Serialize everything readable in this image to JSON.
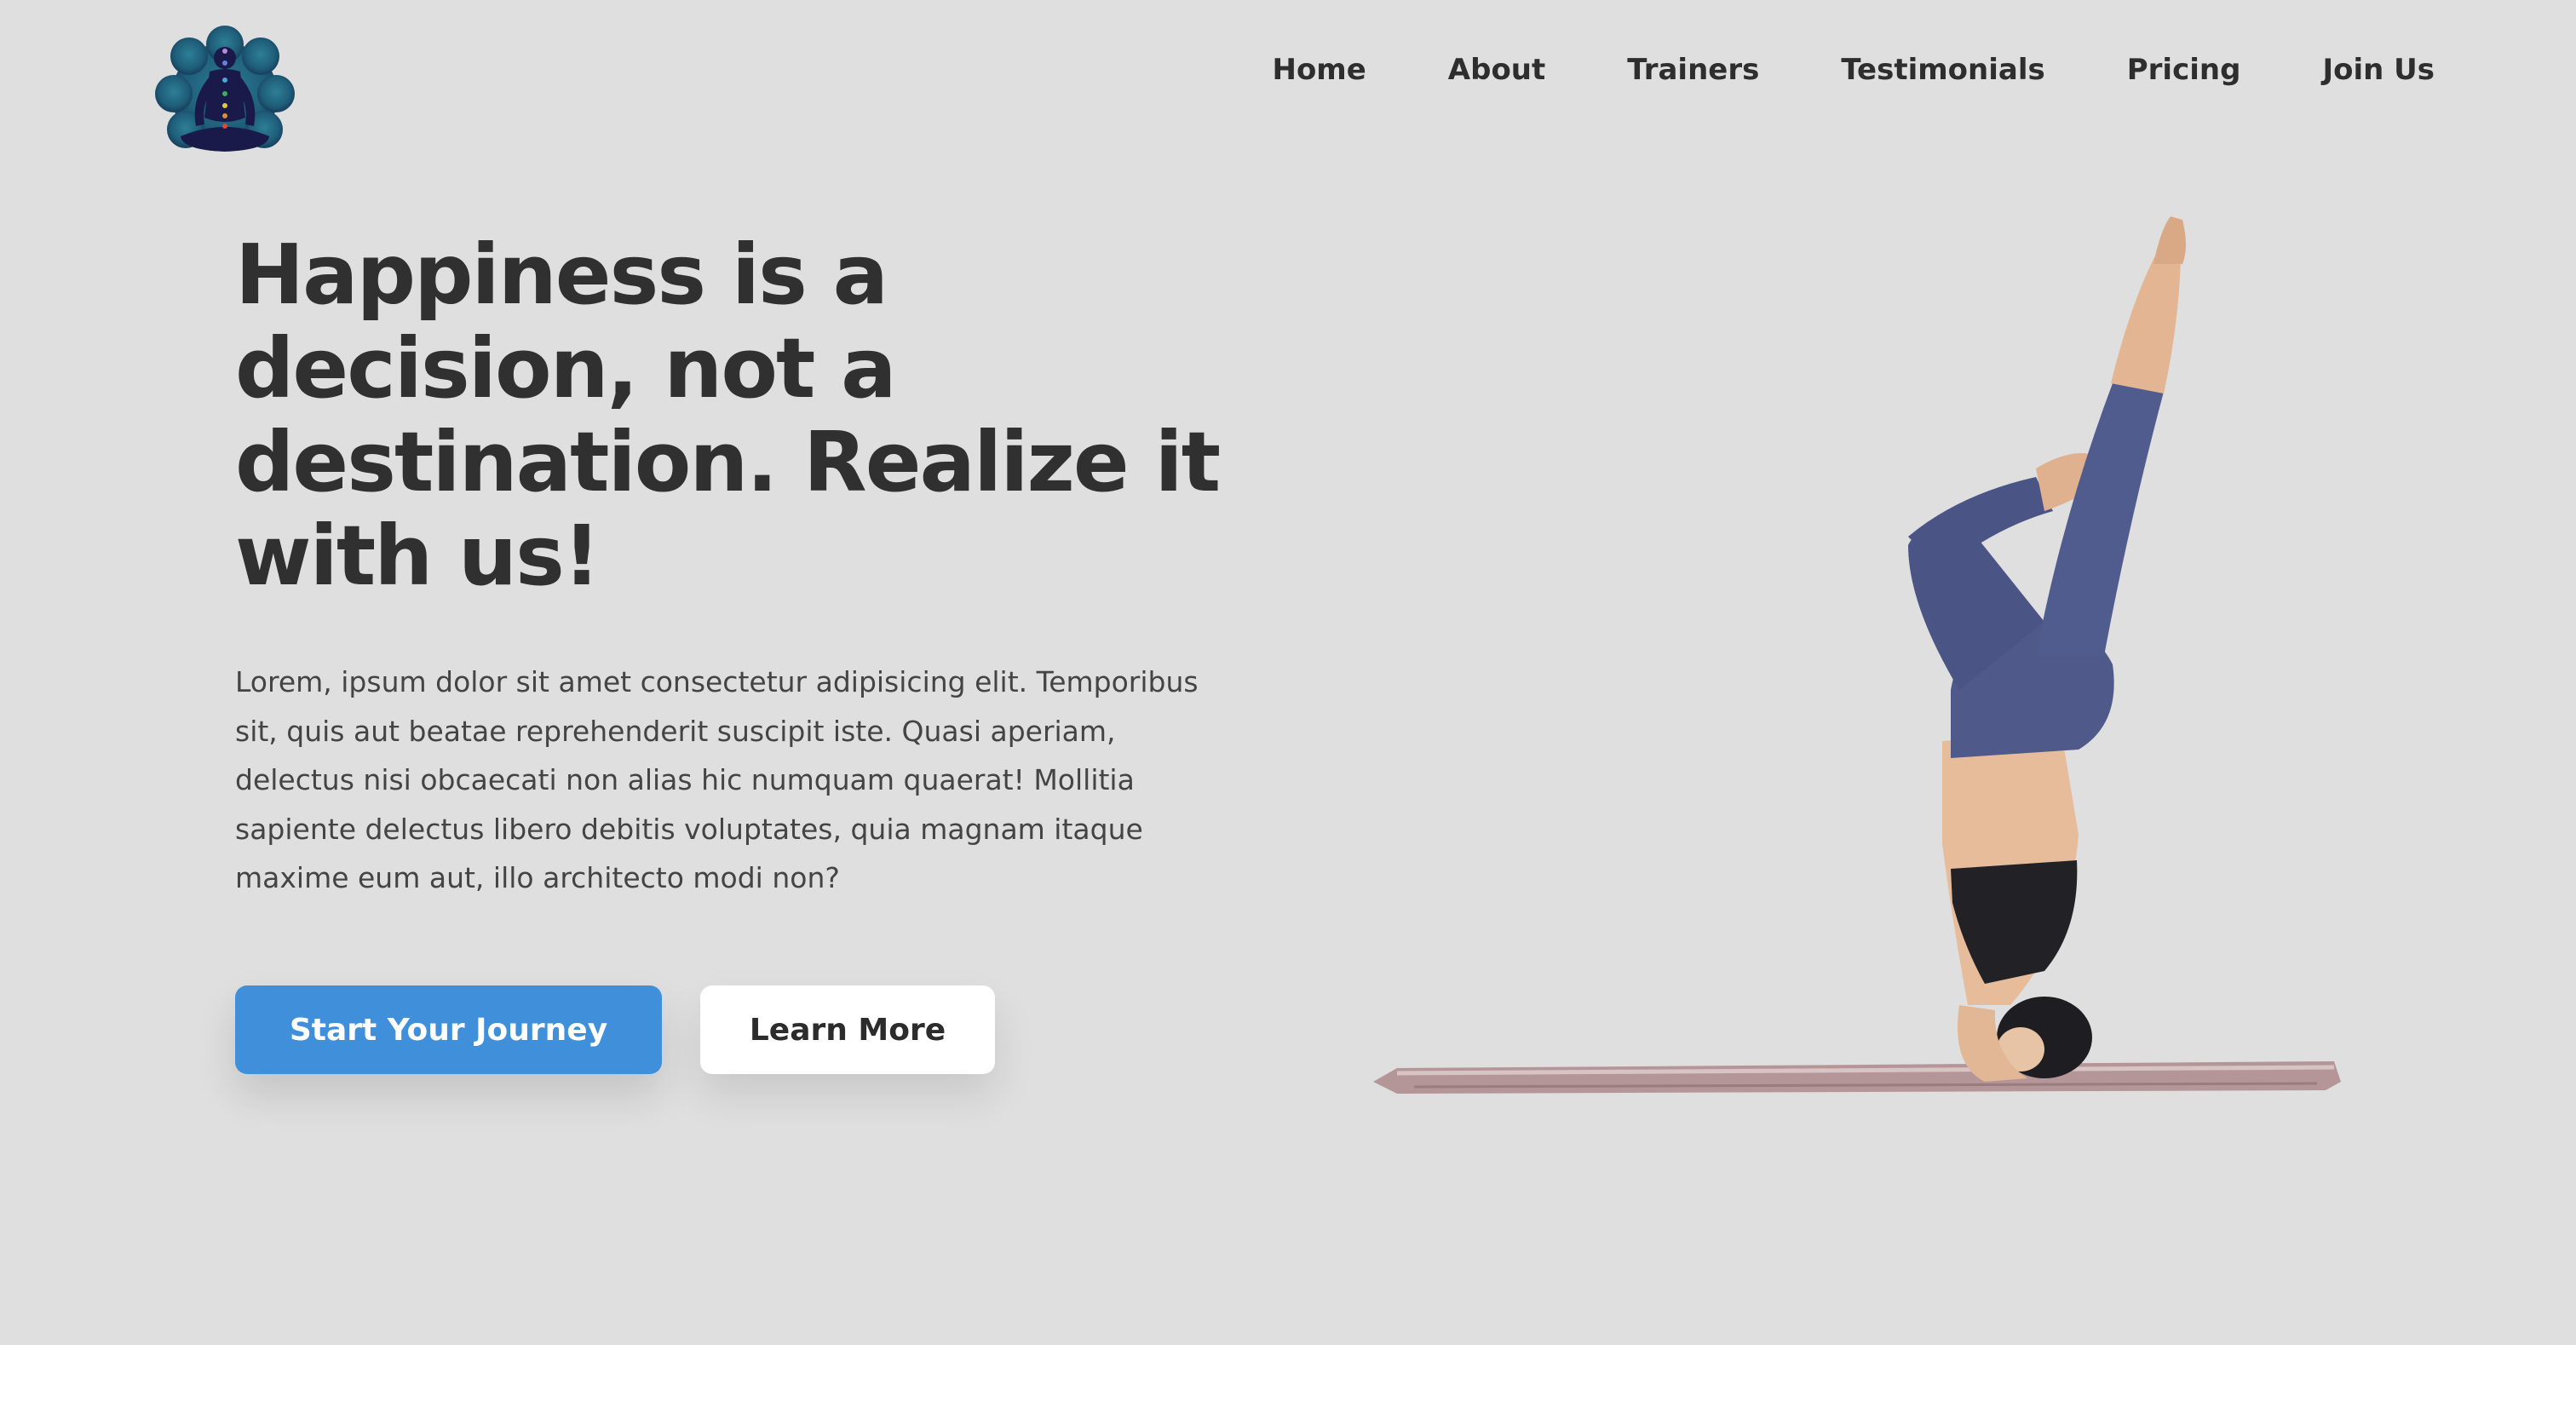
{
  "nav": {
    "items": [
      {
        "label": "Home"
      },
      {
        "label": "About"
      },
      {
        "label": "Trainers"
      },
      {
        "label": "Testimonials"
      },
      {
        "label": "Pricing"
      },
      {
        "label": "Join Us"
      }
    ]
  },
  "hero": {
    "headline": "Happiness is a decision, not a destination. Realize it with us!",
    "body": "Lorem, ipsum dolor sit amet consectetur adipisicing elit. Temporibus sit, quis aut beatae reprehenderit suscipit iste. Quasi aperiam, delectus nisi obcaecati non alias hic numquam quaerat! Mollitia sapiente delectus libero debitis voluptates, quia magnam itaque maxime eum aut, illo architecto modi non?",
    "primary_cta": "Start Your Journey",
    "secondary_cta": "Learn More"
  },
  "icons": {
    "logo": "meditating-figure-chakra-logo",
    "hero_image": "yoga-headstand-photo"
  },
  "colors": {
    "hero_background": "#dfdfe0",
    "primary_button": "#3f8fdb",
    "text_dark": "#303030",
    "legging": "#4f5a8a"
  }
}
